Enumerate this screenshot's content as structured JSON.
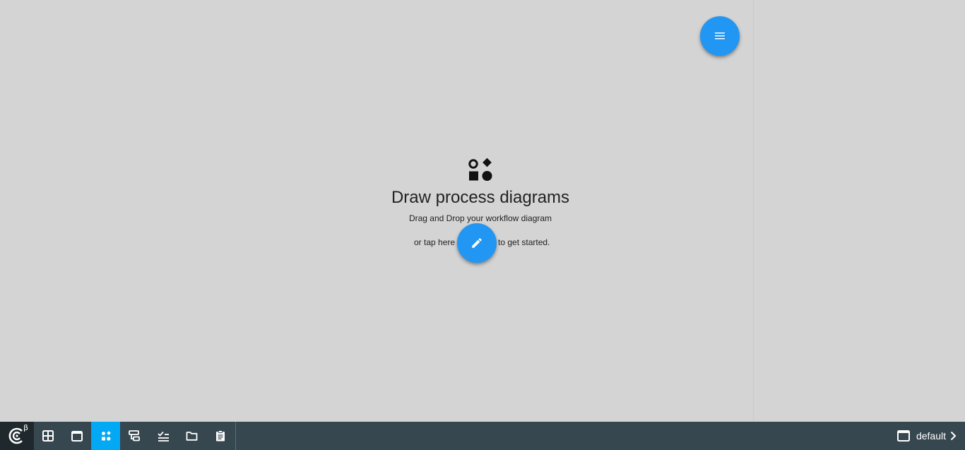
{
  "empty_state": {
    "icon": "shapes-icon",
    "title": "Draw process diagrams",
    "subtitle": "Drag and Drop your workflow diagram",
    "tap_prefix": "or tap here",
    "tap_suffix": "to get started."
  },
  "fab": {
    "menu_icon": "menu-icon",
    "edit_icon": "pencil-icon",
    "color": "#2196f3"
  },
  "taskbar": {
    "logo_beta": "β",
    "buttons": [
      {
        "icon": "grid-icon",
        "active": false
      },
      {
        "icon": "window-icon",
        "active": false
      },
      {
        "icon": "shapes-icon",
        "active": true
      },
      {
        "icon": "flow-icon",
        "active": false
      },
      {
        "icon": "checklist-icon",
        "active": false
      },
      {
        "icon": "folder-icon",
        "active": false
      },
      {
        "icon": "clipboard-icon",
        "active": false
      }
    ],
    "layout_label": "default",
    "background": "#37474f",
    "accent": "#03a9f4"
  }
}
